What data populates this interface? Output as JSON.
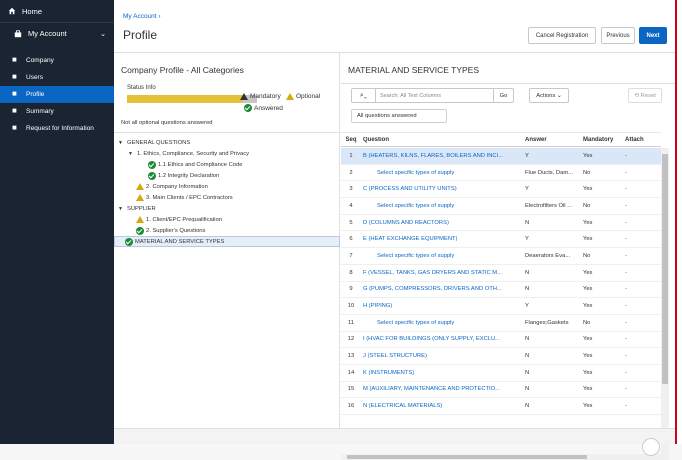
{
  "sidebar": {
    "home": "Home",
    "my_account": "My Account",
    "items": [
      {
        "label": "Company",
        "icon": "building-icon"
      },
      {
        "label": "Users",
        "icon": "users-icon"
      },
      {
        "label": "Profile",
        "icon": "profile-card-icon",
        "active": true
      },
      {
        "label": "Summary",
        "icon": "summary-icon"
      },
      {
        "label": "Request for Information",
        "icon": "request-icon"
      }
    ]
  },
  "header": {
    "breadcrumb": "My Account ›",
    "title": "Profile",
    "buttons": {
      "cancel": "Cancel Registration",
      "previous": "Previous",
      "next": "Next"
    }
  },
  "left": {
    "title": "Company Profile - All Categories",
    "status_label": "Status Info",
    "legend_mandatory": "Mandatory",
    "legend_optional": "Optional",
    "legend_answered": "Answered",
    "note": "Not all optional questions answered",
    "tree": [
      {
        "label": "GENERAL QUESTIONS",
        "level": 0,
        "icon": "caret",
        "sel": false
      },
      {
        "label": "1. Ethics, Compliance, Security and Privacy",
        "level": 1,
        "icon": "caret",
        "sel": false
      },
      {
        "label": "1.1 Ethics and Compliance Code",
        "level": 2,
        "icon": "answered",
        "sel": false
      },
      {
        "label": "1.2 Integrity Declaration",
        "level": 2,
        "icon": "answered",
        "sel": false
      },
      {
        "label": "2. Company Information",
        "level": 1,
        "icon": "warning",
        "sel": false
      },
      {
        "label": "3. Main Clients / EPC Contractors",
        "level": 1,
        "icon": "warning",
        "sel": false
      },
      {
        "label": "SUPPLIER",
        "level": 0,
        "icon": "caret",
        "sel": false
      },
      {
        "label": "1. Client/EPC Prequalification",
        "level": 1,
        "icon": "warning",
        "sel": false
      },
      {
        "label": "2. Supplier's Questions",
        "level": 1,
        "icon": "answered",
        "sel": false
      },
      {
        "label": "MATERIAL AND SERVICE TYPES",
        "level": 0,
        "icon": "answered",
        "sel": true
      }
    ]
  },
  "right": {
    "title": "MATERIAL AND SERVICE TYPES",
    "search_placeholder": "Search: All Text Columns",
    "go": "Go",
    "actions": "Actions",
    "reset": "Reset",
    "filter": "All questions answered",
    "columns": [
      "Seq",
      "Question",
      "Answer",
      "Mandatory",
      "Attach"
    ],
    "rows": [
      {
        "seq": "1",
        "q": "B (HEATERS, KILNS, FLARES, BOILERS AND INCI...",
        "a": "Y",
        "m": "Yes",
        "att": "-",
        "ind": false,
        "hl": true
      },
      {
        "seq": "2",
        "q": "Select specific types of supply",
        "a": "Flue Ducts, Dam...",
        "m": "No",
        "att": "-",
        "ind": true,
        "hl": false
      },
      {
        "seq": "3",
        "q": "C (PROCESS AND UTILITY UNITS)",
        "a": "Y",
        "m": "Yes",
        "att": "-",
        "ind": false,
        "hl": false
      },
      {
        "seq": "4",
        "q": "Select specific types of supply",
        "a": "Electrofilters Oil ...",
        "m": "No",
        "att": "-",
        "ind": true,
        "hl": false
      },
      {
        "seq": "5",
        "q": "D (COLUMNS AND REACTORS)",
        "a": "N",
        "m": "Yes",
        "att": "-",
        "ind": false,
        "hl": false
      },
      {
        "seq": "6",
        "q": "E (HEAT EXCHANGE EQUIPMENT)",
        "a": "Y",
        "m": "Yes",
        "att": "-",
        "ind": false,
        "hl": false
      },
      {
        "seq": "7",
        "q": "Select specific types of supply",
        "a": "Deaerators Eva...",
        "m": "No",
        "att": "-",
        "ind": true,
        "hl": false
      },
      {
        "seq": "8",
        "q": "F (VESSEL, TANKS, GAS DRYERS AND STATIC M...",
        "a": "N",
        "m": "Yes",
        "att": "-",
        "ind": false,
        "hl": false
      },
      {
        "seq": "9",
        "q": "G (PUMPS, COMPRESSORS, DRIVERS AND OTH...",
        "a": "N",
        "m": "Yes",
        "att": "-",
        "ind": false,
        "hl": false
      },
      {
        "seq": "10",
        "q": "H (PIPING)",
        "a": "Y",
        "m": "Yes",
        "att": "-",
        "ind": false,
        "hl": false
      },
      {
        "seq": "11",
        "q": "Select specific types of supply",
        "a": "Flanges;Gaskets",
        "m": "No",
        "att": "-",
        "ind": true,
        "hl": false
      },
      {
        "seq": "12",
        "q": "I (HVAC FOR BUILDINGS (ONLY SUPPLY, EXCLU...",
        "a": "N",
        "m": "Yes",
        "att": "-",
        "ind": false,
        "hl": false
      },
      {
        "seq": "13",
        "q": "J (STEEL STRUCTURE)",
        "a": "N",
        "m": "Yes",
        "att": "-",
        "ind": false,
        "hl": false
      },
      {
        "seq": "14",
        "q": "K (INSTRUMENTS)",
        "a": "N",
        "m": "Yes",
        "att": "-",
        "ind": false,
        "hl": false
      },
      {
        "seq": "15",
        "q": "M (AUXILIARY, MAINTENANCE AND PROTECTIO...",
        "a": "N",
        "m": "Yes",
        "att": "-",
        "ind": false,
        "hl": false
      },
      {
        "seq": "16",
        "q": "N (ELECTRICAL MATERIALS)",
        "a": "N",
        "m": "Yes",
        "att": "-",
        "ind": false,
        "hl": false
      }
    ]
  }
}
